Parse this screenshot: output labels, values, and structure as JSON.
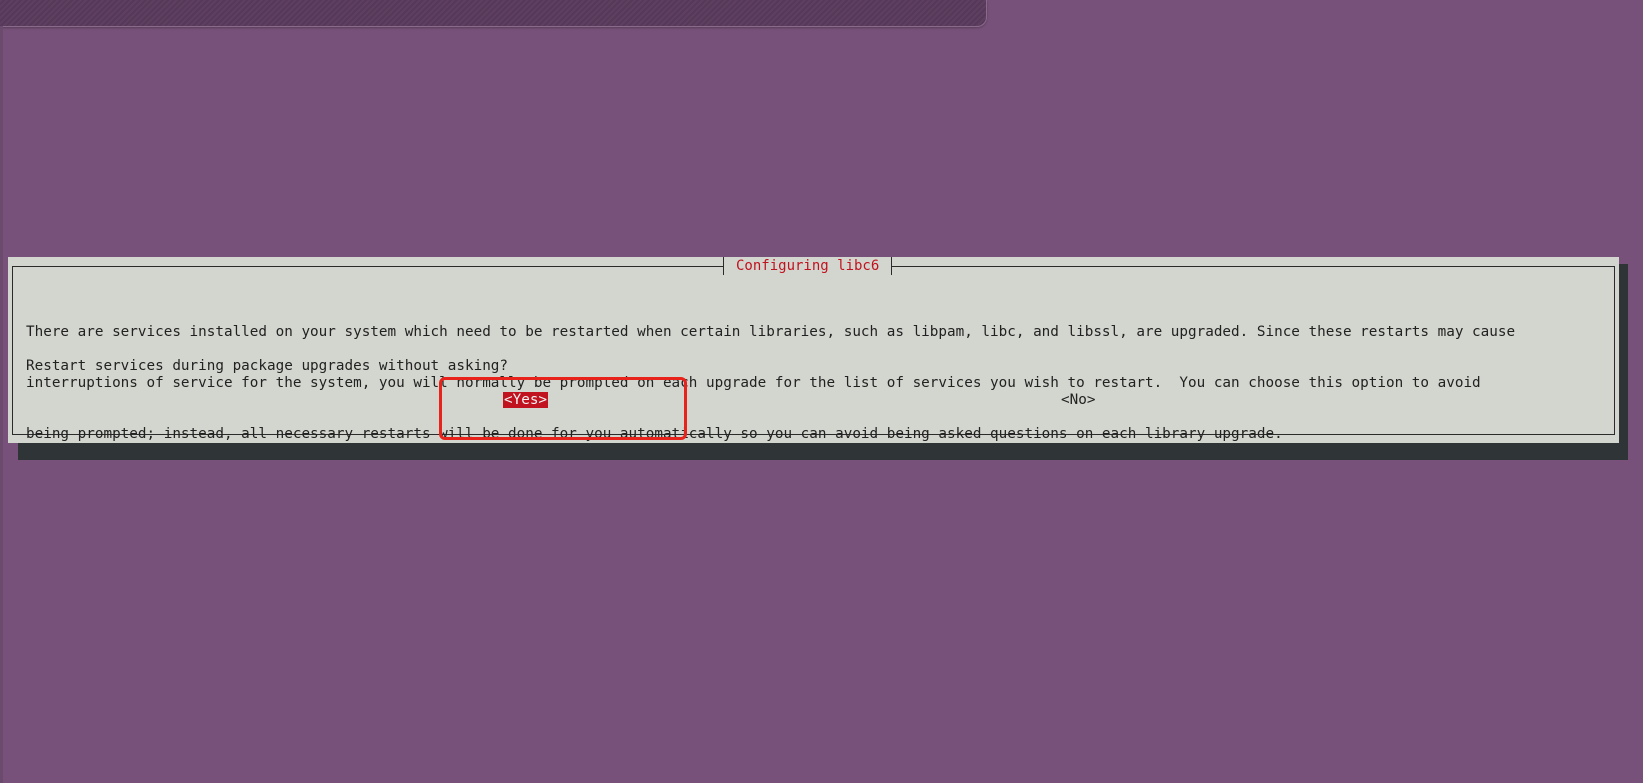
{
  "dialog": {
    "title": "Configuring libc6",
    "body_lines": [
      "There are services installed on your system which need to be restarted when certain libraries, such as libpam, libc, and libssl, are upgraded. Since these restarts may cause",
      "interruptions of service for the system, you will normally be prompted on each upgrade for the list of services you wish to restart.  You can choose this option to avoid",
      "being prompted; instead, all necessary restarts will be done for you automatically so you can avoid being asked questions on each library upgrade."
    ],
    "question": "Restart services during package upgrades without asking?",
    "yes_label": "<Yes>",
    "no_label": "<No>"
  },
  "colors": {
    "desktop_background": "#775179",
    "dialog_background": "#d3d6cf",
    "dialog_shadow": "#2f3437",
    "title_color": "#c1121f",
    "selected_button_background": "#c1121f",
    "highlight_box": "#e8231c"
  }
}
